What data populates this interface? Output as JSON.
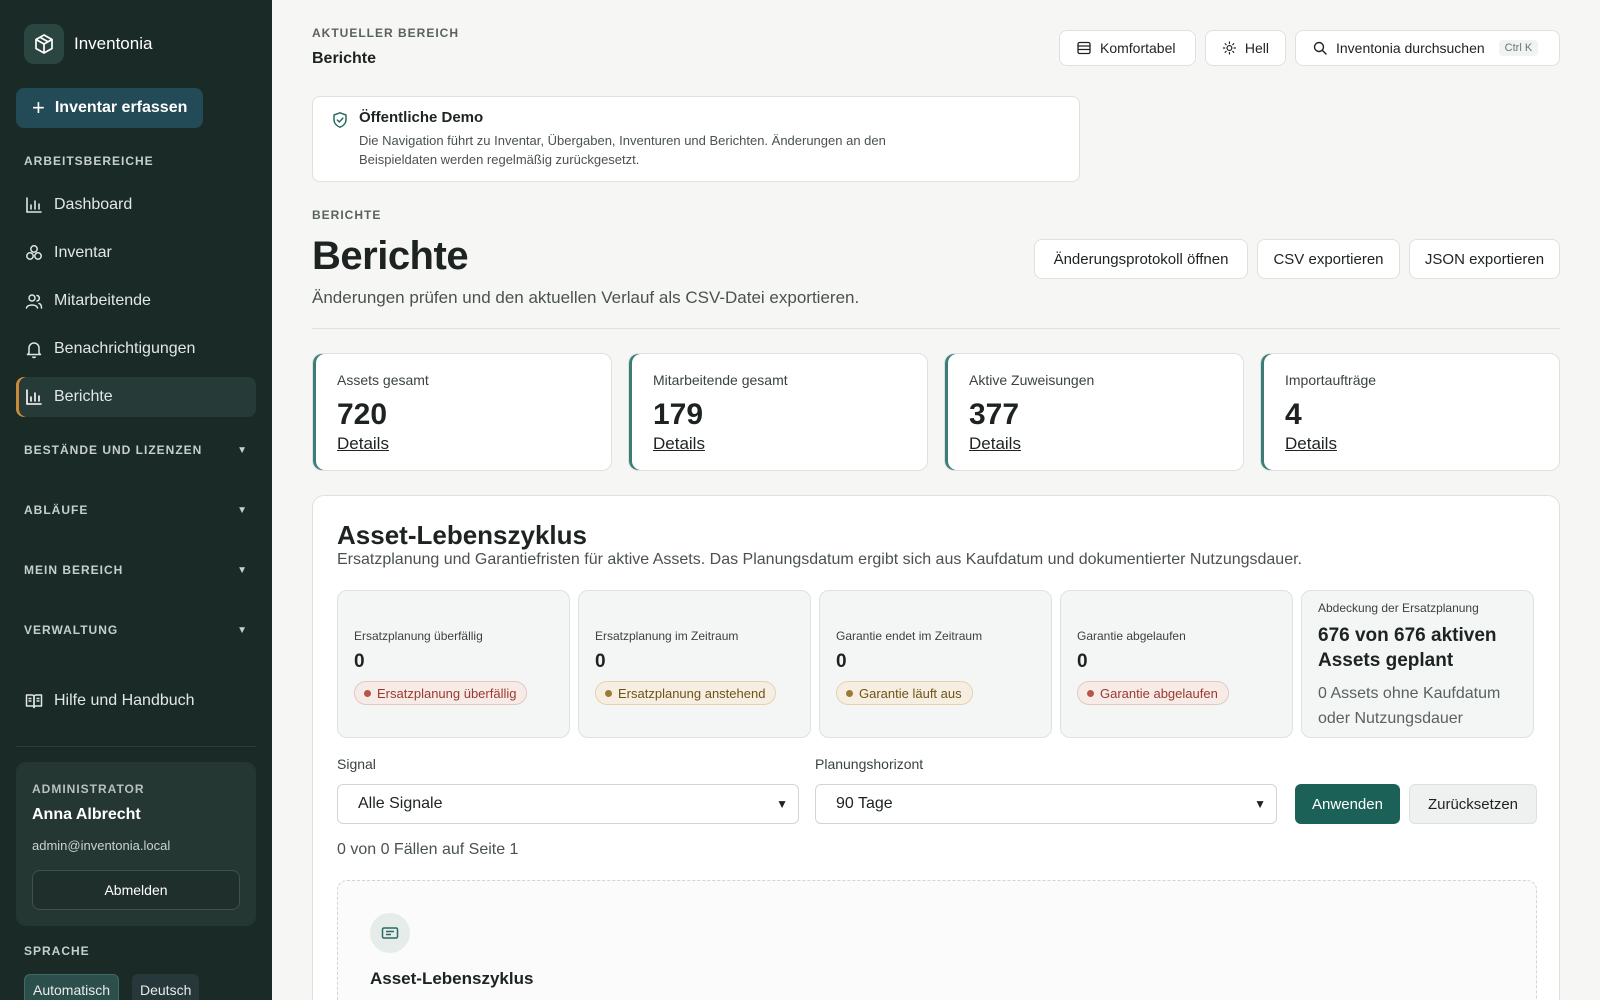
{
  "app": {
    "name": "Inventonia"
  },
  "sidebar": {
    "add_button": "Inventar erfassen",
    "workspaces_heading": "ARBEITSBEREICHE",
    "items": [
      {
        "label": "Dashboard",
        "icon": "bar-chart-icon"
      },
      {
        "label": "Inventar",
        "icon": "boxes-icon"
      },
      {
        "label": "Mitarbeitende",
        "icon": "users-icon"
      },
      {
        "label": "Benachrichtigungen",
        "icon": "bell-icon"
      },
      {
        "label": "Berichte",
        "icon": "bar-chart-icon",
        "active": true
      }
    ],
    "groups": [
      {
        "label": "BESTÄNDE UND LIZENZEN"
      },
      {
        "label": "ABLÄUFE"
      },
      {
        "label": "MEIN BEREICH"
      },
      {
        "label": "VERWALTUNG"
      }
    ],
    "help": "Hilfe und Handbuch",
    "admin": {
      "role": "ADMINISTRATOR",
      "name": "Anna Albrecht",
      "email": "admin@inventonia.local",
      "logout": "Abmelden"
    },
    "language": {
      "heading": "SPRACHE",
      "options": [
        "Automatisch",
        "Deutsch"
      ],
      "selected": "Automatisch"
    }
  },
  "topbar": {
    "current_area_label": "AKTUELLER BEREICH",
    "current_area": "Berichte",
    "density": "Komfortabel",
    "theme": "Hell",
    "search": "Inventonia durchsuchen",
    "search_shortcut": "Ctrl K"
  },
  "demo_notice": {
    "title": "Öffentliche Demo",
    "text": "Die Navigation führt zu Inventar, Übergaben, Inventuren und Berichten. Änderungen an den Beispieldaten werden regelmäßig zurückgesetzt."
  },
  "page": {
    "eyebrow": "BERICHTE",
    "title": "Berichte",
    "subtitle": "Änderungen prüfen und den aktuellen Verlauf als CSV-Datei exportieren.",
    "actions": [
      "Änderungsprotokoll öffnen",
      "CSV exportieren",
      "JSON exportieren"
    ]
  },
  "stats": [
    {
      "label": "Assets gesamt",
      "value": "720",
      "link": "Details"
    },
    {
      "label": "Mitarbeitende gesamt",
      "value": "179",
      "link": "Details"
    },
    {
      "label": "Aktive Zuweisungen",
      "value": "377",
      "link": "Details"
    },
    {
      "label": "Importaufträge",
      "value": "4",
      "link": "Details"
    }
  ],
  "lifecycle": {
    "title": "Asset-Lebenszyklus",
    "subtitle": "Ersatzplanung und Garantiefristen für aktive Assets. Das Planungsdatum ergibt sich aus Kaufdatum und dokumentierter Nutzungsdauer.",
    "kpis": [
      {
        "label": "Ersatzplanung überfällig",
        "value": "0",
        "pill": "Ersatzplanung überfällig",
        "tone": "red"
      },
      {
        "label": "Ersatzplanung im Zeitraum",
        "value": "0",
        "pill": "Ersatzplanung anstehend",
        "tone": "amber"
      },
      {
        "label": "Garantie endet im Zeitraum",
        "value": "0",
        "pill": "Garantie läuft aus",
        "tone": "amber"
      },
      {
        "label": "Garantie abgelaufen",
        "value": "0",
        "pill": "Garantie abgelaufen",
        "tone": "red"
      }
    ],
    "coverage": {
      "label": "Abdeckung der Ersatzplanung",
      "value": "676 von 676 aktiven Assets geplant",
      "note": "0 Assets ohne Kaufdatum oder Nutzungsdauer"
    },
    "filters": {
      "signal_label": "Signal",
      "signal_value": "Alle Signale",
      "horizon_label": "Planungshorizont",
      "horizon_value": "90 Tage",
      "apply": "Anwenden",
      "reset": "Zurücksetzen"
    },
    "count": "0 von 0 Fällen auf Seite 1",
    "empty_title": "Asset-Lebenszyklus"
  },
  "colors": {
    "sidebar_bg": "#1a2a27",
    "accent": "#1b6157",
    "active_marker": "#c98a3b"
  }
}
